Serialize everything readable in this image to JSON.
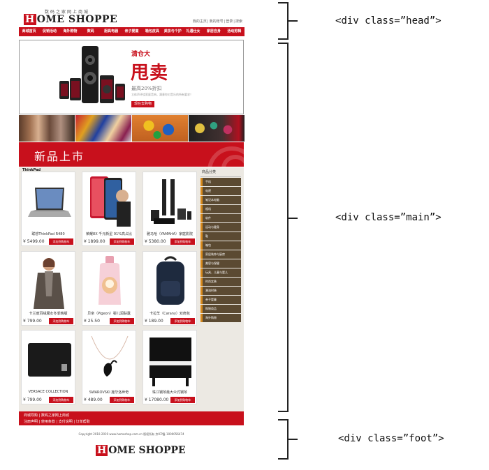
{
  "head": {
    "logo_sub": "数码之家网上商城",
    "logo_letter": "H",
    "logo_rest": "OME SHOPPE",
    "links": [
      "我的主页",
      "我的账号",
      "登录",
      "搜索"
    ],
    "nav": [
      "商城首页",
      "促销活动",
      "海外购物",
      "数码",
      "厨具电器",
      "亲子婴童",
      "箱包皮具",
      "美妆与个护",
      "礼遇仕女",
      "家居自身",
      "活动剪辑"
    ]
  },
  "banner": {
    "kicker": "清仓大",
    "title": "甩卖",
    "sub": "最高20%折扣",
    "desc": "立体声环绕家庭音响，满意你对音乐的所有要求！",
    "button": "现在去购物"
  },
  "new_arrivals": {
    "title": "新品上市",
    "brand": "ThinkPad"
  },
  "products": [
    {
      "name": "联想ThinkPad R480",
      "price": "¥ 5499.00",
      "button": "添加到购物车",
      "icon": "laptop-image"
    },
    {
      "name": "荣耀8X 千元新星 91%高占比",
      "price": "¥ 1899.00",
      "button": "添加到购物车",
      "icon": "phone-image"
    },
    {
      "name": "雅马哈（YAMAHA）家庭影院",
      "price": "¥ 5380.00",
      "button": "添加到购物车",
      "icon": "home-theater-image"
    },
    {
      "name": "卡兰度羽绒服女冬季韩版",
      "price": "¥ 799.00",
      "button": "添加到购物车",
      "icon": "coat-image"
    },
    {
      "name": "贝亲（Pigeon）婴儿润肤露",
      "price": "¥ 25.50",
      "button": "添加到购物车",
      "icon": "lotion-image"
    },
    {
      "name": "卡拉羊（Carany）双肩包",
      "price": "¥ 189.00",
      "button": "添加到购物车",
      "icon": "backpack-image"
    },
    {
      "name": "VERSACE COLLECTION",
      "price": "¥ 799.00",
      "button": "添加到购物车",
      "icon": "wallet-image"
    },
    {
      "name": "SWAROVSKI 施华洛世奇",
      "price": "¥ 489.00",
      "button": "添加到购物车",
      "icon": "necklace-image"
    },
    {
      "name": "珠江钢琴最大众式钢琴",
      "price": "¥ 17080.00",
      "button": "添加到购物车",
      "icon": "piano-image"
    }
  ],
  "categories": {
    "title": "商品分类",
    "items": [
      "手机",
      "电视",
      "笔记本电脑",
      "相机",
      "软件",
      "运动与健身",
      "鞋",
      "箱包",
      "家居装饰与厨房",
      "美容与保健",
      "玩具、儿童与婴儿",
      "时尚女装",
      "潮流时装",
      "亲子婴童",
      "购物商品",
      "海外购物"
    ]
  },
  "footer": {
    "line1": "商城导购 | 数码之家网上商城",
    "line2": "注册声明 | 使用条款 | 支付说明 | 订单帮助",
    "copyright": "Copyright 2010-2019 www.homeshop.com.cn 版权所有 京ICP备 1000056474",
    "logo_letter": "H",
    "logo_rest": "OME SHOPPE"
  },
  "annotations": {
    "head": "<div class=”head”>",
    "main": "<div class=”main”>",
    "foot": "<div class=”foot”>"
  },
  "colors": {
    "brand_red": "#c8101c",
    "category_brown": "#5b4a32",
    "category_accent": "#d88a1c"
  }
}
